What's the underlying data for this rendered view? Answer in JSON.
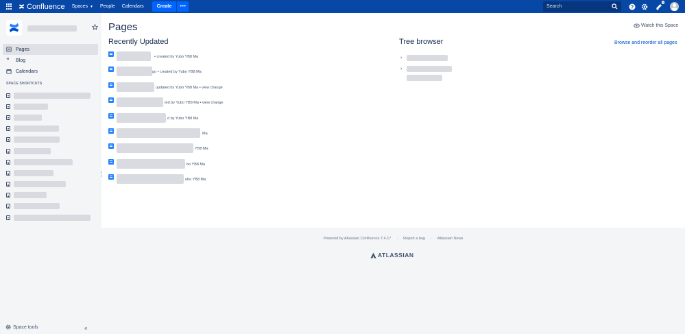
{
  "topbar": {
    "logo_text": "Confluence",
    "nav": [
      {
        "label": "Spaces",
        "dropdown": true
      },
      {
        "label": "People"
      },
      {
        "label": "Calendars"
      }
    ],
    "create_label": "Create",
    "more_label": "•••",
    "search_placeholder": "Search",
    "notification_count": "3",
    "colors": {
      "bar": "#0747a6",
      "create": "#0065ff"
    }
  },
  "sidebar": {
    "nav_items": [
      {
        "label": "Pages",
        "icon": "pages-icon",
        "active": true
      },
      {
        "label": "Blog",
        "icon": "quote-icon",
        "active": false
      },
      {
        "label": "Calendars",
        "icon": "calendar-icon",
        "active": false
      }
    ],
    "shortcuts_title": "SPACE SHORTCUTS",
    "shortcut_count": 12,
    "space_tools_label": "Space tools"
  },
  "main": {
    "title": "Pages",
    "watch_label": "Watch this Space",
    "recently_updated_title": "Recently Updated",
    "tree_browser_title": "Tree browser",
    "browse_link": "Browse and reorder all pages",
    "recent": [
      {
        "meta": "• created by Yubo YB8 Ma"
      },
      {
        "meta": "go • created by Yubo YB8 Ma"
      },
      {
        "meta": "updated by Yubo YB8 Ma • view change"
      },
      {
        "meta": "ted by Yubo YB8 Ma • view change"
      },
      {
        "meta": "d by Yubo YB8 Ma"
      },
      {
        "meta": "Ma"
      },
      {
        "meta": "YB8 Ma"
      },
      {
        "meta": "bo YB8 Ma"
      },
      {
        "meta": "ubo YB8 Ma"
      }
    ]
  },
  "footer": {
    "powered": "Powered by Atlassian Confluence 7.4.17",
    "sep": "·",
    "report": "Report a bug",
    "news": "Atlassian News",
    "brand": "ATLASSIAN"
  }
}
